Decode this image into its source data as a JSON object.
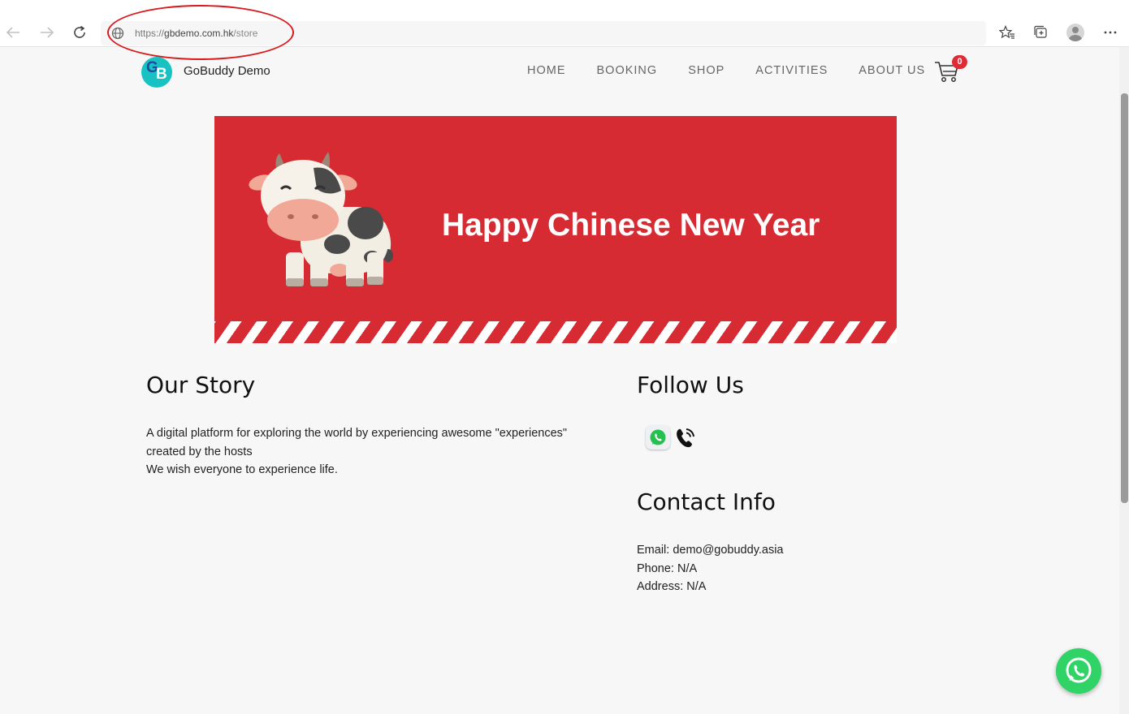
{
  "browser": {
    "url_scheme": "https://",
    "url_domain": "gbdemo.com.hk",
    "url_path": "/store",
    "icons": [
      "back-arrow-icon",
      "forward-arrow-icon",
      "reload-icon",
      "site-info-icon",
      "favorites-icon",
      "collections-icon",
      "profile-icon",
      "more-options-icon"
    ],
    "annotation_color": "#d9191c"
  },
  "site": {
    "logo_letters": [
      "G",
      "B"
    ],
    "name": "GoBuddy Demo",
    "colors": {
      "logo_bg": "#19c2c2",
      "logo_g": "#1e4aa0",
      "banner_red": "#d62b32",
      "whatsapp_green": "#2fd366",
      "badge_red": "#e02b35"
    }
  },
  "nav": {
    "items": [
      "HOME",
      "BOOKING",
      "SHOP",
      "ACTIVITIES",
      "ABOUT US"
    ],
    "cart_count": "0"
  },
  "banner": {
    "title": "Happy Chinese New Year"
  },
  "story": {
    "heading": "Our Story",
    "line1": "A digital platform for exploring the world by experiencing awesome \"experiences\"",
    "line2": "created by the hosts",
    "line3": "We wish everyone to experience life."
  },
  "follow": {
    "heading": "Follow Us",
    "icons": [
      "whatsapp-icon",
      "phone-icon"
    ]
  },
  "contact": {
    "heading": "Contact Info",
    "email": "Email: demo@gobuddy.asia",
    "phone": "Phone: N/A",
    "address": "Address: N/A"
  }
}
